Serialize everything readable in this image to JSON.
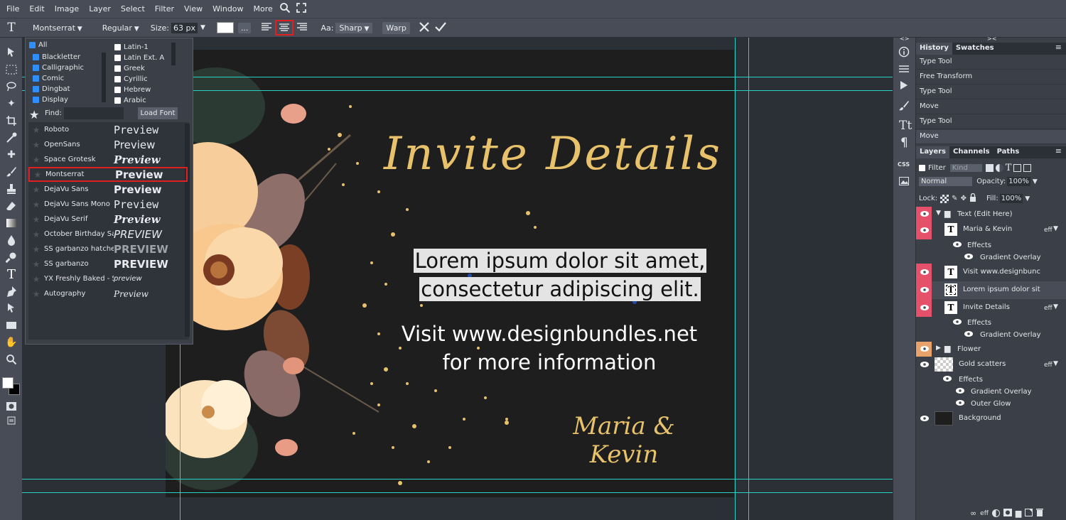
{
  "menu": [
    "File",
    "Edit",
    "Image",
    "Layer",
    "Select",
    "Filter",
    "View",
    "Window",
    "More"
  ],
  "options": {
    "font": "Montserrat",
    "style": "Regular",
    "size_label": "Size:",
    "size_value": "63 px",
    "dots": "...",
    "aa_label": "Aa:",
    "aa_value": "Sharp",
    "warp": "Warp"
  },
  "font_panel": {
    "all_label": "All",
    "categories_left": [
      "Blackletter",
      "Calligraphic",
      "Comic",
      "Dingbat",
      "Display"
    ],
    "categories_right": [
      "Latin-1",
      "Latin Ext. A",
      "Greek",
      "Cyrillic",
      "Hebrew",
      "Arabic"
    ],
    "find_label": "Find:",
    "load_font": "Load Font",
    "fonts": [
      {
        "name": "Roboto",
        "preview": "Preview"
      },
      {
        "name": "OpenSans",
        "preview": "Preview"
      },
      {
        "name": "Space Grotesk",
        "preview": "Preview"
      },
      {
        "name": "Montserrat",
        "preview": "Preview"
      },
      {
        "name": "DejaVu Sans",
        "preview": "Preview"
      },
      {
        "name": "DejaVu Sans Mono",
        "preview": "Preview"
      },
      {
        "name": "DejaVu Serif",
        "preview": "Preview"
      },
      {
        "name": "October Birthday Sa",
        "preview": "PREVIEW"
      },
      {
        "name": "SS garbanzo hatche",
        "preview": "PREVIEW"
      },
      {
        "name": "SS garbanzo",
        "preview": "PREVIEW"
      },
      {
        "name": "YX Freshly Baked - S",
        "preview": "preview"
      },
      {
        "name": "Autography",
        "preview": "Preview"
      }
    ]
  },
  "canvas": {
    "title_text": "Invite Details",
    "lorem_line1": "Lorem ipsum dolor sit amet,",
    "lorem_line2": "consectetur adipiscing elit.",
    "visit_line1": "Visit www.designbundles.net",
    "visit_line2": "for more information",
    "names": "Maria & Kevin",
    "gold": "#e8c16b"
  },
  "history": {
    "tabs": [
      "History",
      "Swatches"
    ],
    "items": [
      "Type Tool",
      "Free Transform",
      "Type Tool",
      "Move",
      "Type Tool",
      "Move"
    ]
  },
  "layers": {
    "tabs": [
      "Layers",
      "Channels",
      "Paths"
    ],
    "filter_label": "Filter",
    "kind_label": "Kind",
    "blend": "Normal",
    "opacity_label": "Opacity:",
    "opacity": "100%",
    "lock_label": "Lock:",
    "fill_label": "Fill:",
    "fill": "100%",
    "items": [
      {
        "label": "Text (Edit Here)"
      },
      {
        "label": "Maria & Kevin",
        "eff": "eff"
      },
      {
        "label": "Effects"
      },
      {
        "label": "Gradient Overlay"
      },
      {
        "label": "Visit www.designbunc"
      },
      {
        "label": "Lorem ipsum dolor sit"
      },
      {
        "label": "Invite Details",
        "eff": "eff"
      },
      {
        "label": "Effects"
      },
      {
        "label": "Gradient Overlay"
      },
      {
        "label": "Flower"
      },
      {
        "label": "Gold scatters",
        "eff": "eff"
      },
      {
        "label": "Effects"
      },
      {
        "label": "Gradient Overlay"
      },
      {
        "label": "Outer Glow"
      },
      {
        "label": "Background"
      }
    ]
  },
  "icons": {
    "iconcol_css": "CSS"
  }
}
